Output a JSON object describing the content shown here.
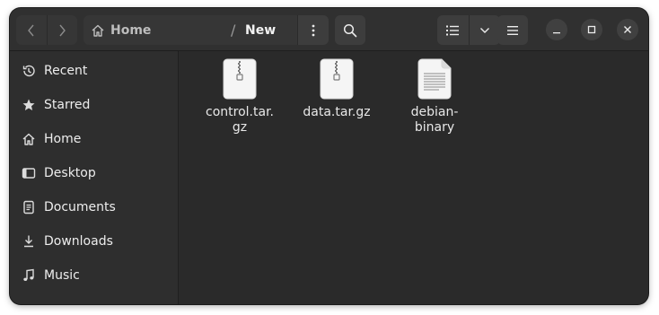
{
  "headerbar": {
    "back_icon": "go-previous-icon",
    "forward_icon": "go-next-icon",
    "path": {
      "home_label": "Home",
      "separator": "/",
      "current_label": "New"
    },
    "path_menu_icon": "view-more-vertical-icon",
    "search_icon": "search-icon",
    "view_icon": "view-list-icon",
    "view_dropdown_icon": "chevron-down-icon",
    "main_menu_icon": "hamburger-menu-icon",
    "window_controls": [
      "minimize",
      "maximize",
      "close"
    ]
  },
  "sidebar": {
    "items": [
      {
        "label": "Recent",
        "icon": "recent-clock-icon"
      },
      {
        "label": "Starred",
        "icon": "star-icon"
      },
      {
        "label": "Home",
        "icon": "home-icon"
      },
      {
        "label": "Desktop",
        "icon": "desktop-icon"
      },
      {
        "label": "Documents",
        "icon": "documents-icon"
      },
      {
        "label": "Downloads",
        "icon": "downloads-icon"
      },
      {
        "label": "Music",
        "icon": "music-icon"
      }
    ]
  },
  "files": [
    {
      "name": "control.tar.\ngz",
      "icon": "archive-file-icon"
    },
    {
      "name": "data.tar.gz",
      "icon": "archive-file-icon"
    },
    {
      "name": "debian-\nbinary",
      "icon": "text-file-icon"
    }
  ],
  "colors": {
    "window_bg": "#2c2c2c",
    "headerbar_bg": "#303030",
    "button_bg": "#3d3d3d",
    "text": "#ededed"
  }
}
